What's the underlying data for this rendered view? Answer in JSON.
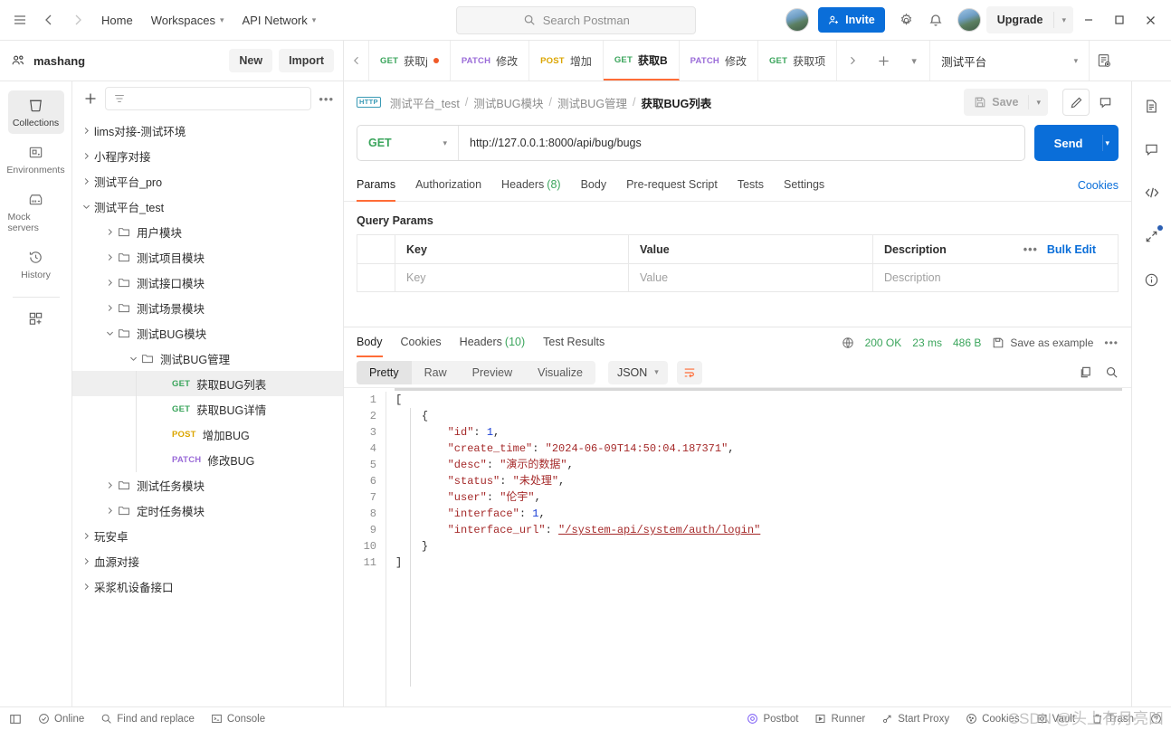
{
  "topbar": {
    "menu_icon": "hamburger-icon",
    "back_icon": "arrow-left-icon",
    "forward_icon": "arrow-right-icon",
    "home": "Home",
    "workspaces": "Workspaces",
    "api_network": "API Network",
    "search_placeholder": "Search Postman",
    "invite": "Invite",
    "settings_icon": "gear-icon",
    "notifications_icon": "bell-icon",
    "upgrade": "Upgrade",
    "minimize": "–",
    "maximize": "□",
    "close": "✕"
  },
  "workspace": {
    "name": "mashang",
    "new_label": "New",
    "import_label": "Import"
  },
  "tabs": {
    "items": [
      {
        "method": "GET",
        "label": "获取j",
        "unsaved": true,
        "active": false
      },
      {
        "method": "PATCH",
        "label": "修改",
        "unsaved": false,
        "active": false
      },
      {
        "method": "POST",
        "label": "增加",
        "unsaved": false,
        "active": false
      },
      {
        "method": "GET",
        "label": "获取B",
        "unsaved": false,
        "active": true
      },
      {
        "method": "PATCH",
        "label": "修改",
        "unsaved": false,
        "active": false
      },
      {
        "method": "GET",
        "label": "获取项",
        "unsaved": false,
        "active": false
      }
    ],
    "environment": "测试平台"
  },
  "rail": {
    "items": [
      {
        "label": "Collections",
        "icon": "collections-icon",
        "active": true
      },
      {
        "label": "Environments",
        "icon": "environments-icon",
        "active": false
      },
      {
        "label": "Mock servers",
        "icon": "mock-servers-icon",
        "active": false
      },
      {
        "label": "History",
        "icon": "history-icon",
        "active": false
      }
    ],
    "add_label": "new-module-icon"
  },
  "sidebar": {
    "filter_placeholder": "",
    "tree": [
      {
        "label": "lims对接-测试环境",
        "depth": 0,
        "type": "collection",
        "expanded": false
      },
      {
        "label": "小程序对接",
        "depth": 0,
        "type": "collection",
        "expanded": false
      },
      {
        "label": "测试平台_pro",
        "depth": 0,
        "type": "collection",
        "expanded": false
      },
      {
        "label": "测试平台_test",
        "depth": 0,
        "type": "collection",
        "expanded": true
      },
      {
        "label": "用户模块",
        "depth": 1,
        "type": "folder",
        "expanded": false
      },
      {
        "label": "测试项目模块",
        "depth": 1,
        "type": "folder",
        "expanded": false
      },
      {
        "label": "测试接口模块",
        "depth": 1,
        "type": "folder",
        "expanded": false
      },
      {
        "label": "测试场景模块",
        "depth": 1,
        "type": "folder",
        "expanded": false
      },
      {
        "label": "测试BUG模块",
        "depth": 1,
        "type": "folder",
        "expanded": true
      },
      {
        "label": "测试BUG管理",
        "depth": 2,
        "type": "folder",
        "expanded": true
      },
      {
        "label": "获取BUG列表",
        "depth": 3,
        "type": "request",
        "method": "GET",
        "selected": true
      },
      {
        "label": "获取BUG详情",
        "depth": 3,
        "type": "request",
        "method": "GET",
        "selected": false
      },
      {
        "label": "增加BUG",
        "depth": 3,
        "type": "request",
        "method": "POST",
        "selected": false
      },
      {
        "label": "修改BUG",
        "depth": 3,
        "type": "request",
        "method": "PATCH",
        "selected": false
      },
      {
        "label": "测试任务模块",
        "depth": 1,
        "type": "folder",
        "expanded": false
      },
      {
        "label": "定时任务模块",
        "depth": 1,
        "type": "folder",
        "expanded": false
      },
      {
        "label": "玩安卓",
        "depth": 0,
        "type": "collection",
        "expanded": false
      },
      {
        "label": "血源对接",
        "depth": 0,
        "type": "collection",
        "expanded": false
      },
      {
        "label": "采浆机设备接口",
        "depth": 0,
        "type": "collection",
        "expanded": false
      }
    ]
  },
  "request": {
    "protocol_badge": "HTTP",
    "breadcrumb": [
      "测试平台_test",
      "测试BUG模块",
      "测试BUG管理",
      "获取BUG列表"
    ],
    "save_label": "Save",
    "method": "GET",
    "url": "http://127.0.0.1:8000/api/bug/bugs",
    "send_label": "Send",
    "tabs": [
      {
        "label": "Params",
        "active": true
      },
      {
        "label": "Authorization",
        "active": false
      },
      {
        "label": "Headers",
        "count": "(8)",
        "active": false
      },
      {
        "label": "Body",
        "active": false
      },
      {
        "label": "Pre-request Script",
        "active": false
      },
      {
        "label": "Tests",
        "active": false
      },
      {
        "label": "Settings",
        "active": false
      }
    ],
    "cookies_link": "Cookies",
    "query_params_title": "Query Params",
    "params_headers": [
      "Key",
      "Value",
      "Description"
    ],
    "params_placeholder_row": [
      "Key",
      "Value",
      "Description"
    ],
    "bulk_edit": "Bulk Edit"
  },
  "response": {
    "tabs": [
      {
        "label": "Body",
        "active": true
      },
      {
        "label": "Cookies",
        "active": false
      },
      {
        "label": "Headers",
        "count": "(10)",
        "active": false
      },
      {
        "label": "Test Results",
        "active": false
      }
    ],
    "status": "200 OK",
    "time": "23 ms",
    "size": "486 B",
    "save_example": "Save as example",
    "view_modes": [
      "Pretty",
      "Raw",
      "Preview",
      "Visualize"
    ],
    "active_view": "Pretty",
    "format": "JSON",
    "lines": [
      {
        "n": "1",
        "text": "["
      },
      {
        "n": "2",
        "text": "    {"
      },
      {
        "n": "3",
        "text": "        \"id\": 1,"
      },
      {
        "n": "4",
        "text": "        \"create_time\": \"2024-06-09T14:50:04.187371\","
      },
      {
        "n": "5",
        "text": "        \"desc\": \"演示的数据\","
      },
      {
        "n": "6",
        "text": "        \"status\": \"未处理\","
      },
      {
        "n": "7",
        "text": "        \"user\": \"伦宇\","
      },
      {
        "n": "8",
        "text": "        \"interface\": 1,"
      },
      {
        "n": "9",
        "text": "        \"interface_url\": \"/system-api/system/auth/login\""
      },
      {
        "n": "10",
        "text": "    }"
      },
      {
        "n": "11",
        "text": "]"
      }
    ]
  },
  "right_rail": {
    "items": [
      {
        "icon": "document-icon"
      },
      {
        "icon": "comment-icon"
      },
      {
        "icon": "code-icon"
      },
      {
        "icon": "expand-arrows-icon",
        "badge": true
      },
      {
        "icon": "info-icon"
      }
    ]
  },
  "status_bar": {
    "left": [
      {
        "label": "",
        "icon": "sidebar-toggle-icon"
      },
      {
        "label": "Online",
        "icon": "online-icon"
      },
      {
        "label": "Find and replace",
        "icon": "search-icon"
      },
      {
        "label": "Console",
        "icon": "console-icon"
      }
    ],
    "right": [
      {
        "label": "Postbot",
        "icon": "postbot-icon"
      },
      {
        "label": "Runner",
        "icon": "runner-icon"
      },
      {
        "label": "Start Proxy",
        "icon": "proxy-icon"
      },
      {
        "label": "Cookies",
        "icon": "cookies-icon"
      },
      {
        "label": "Vault",
        "icon": "vault-icon"
      },
      {
        "label": "Trash",
        "icon": "trash-icon"
      },
      {
        "label": "",
        "icon": "help-icon"
      }
    ]
  },
  "watermark": "CSDN @头上有月亮凹",
  "colors": {
    "accent": "#ff6c37",
    "primary": "#0a6ed9",
    "get": "#3ba55c",
    "post": "#dba500",
    "patch": "#9a6bd8"
  }
}
